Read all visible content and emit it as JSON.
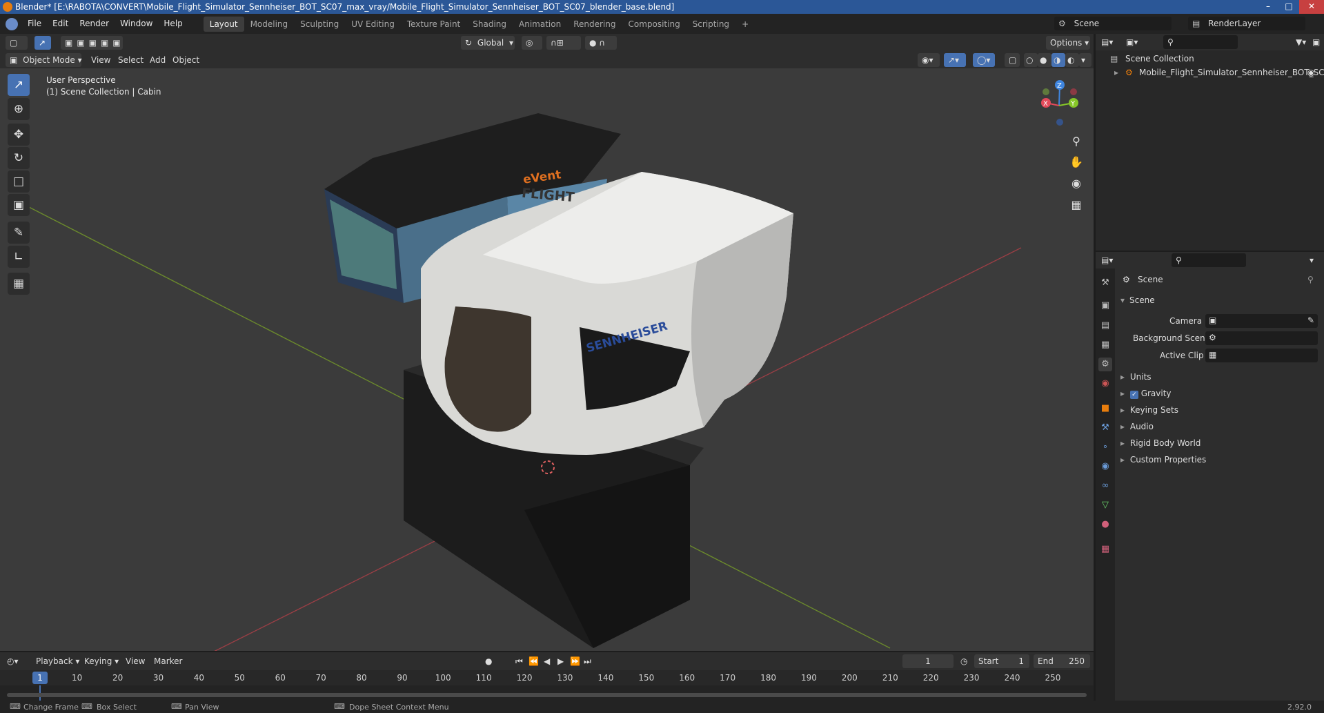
{
  "window": {
    "title": "Blender* [E:\\RABOTA\\CONVERT\\Mobile_Flight_Simulator_Sennheiser_BOT_SC07_max_vray/Mobile_Flight_Simulator_Sennheiser_BOT_SC07_blender_base.blend]"
  },
  "menu": {
    "items": [
      "File",
      "Edit",
      "Render",
      "Window",
      "Help"
    ]
  },
  "workspaces": [
    "Layout",
    "Modeling",
    "Sculpting",
    "UV Editing",
    "Texture Paint",
    "Shading",
    "Animation",
    "Rendering",
    "Compositing",
    "Scripting"
  ],
  "active_workspace": "Layout",
  "add_workspace": "+",
  "scene_selector": {
    "value": "Scene"
  },
  "renderlayer_selector": {
    "value": "RenderLayer"
  },
  "viewport_header": {
    "transform_orientation": "Global",
    "options": "Options",
    "mode": "Object Mode",
    "menus": [
      "View",
      "Select",
      "Add",
      "Object"
    ]
  },
  "viewport": {
    "perspective": "User Perspective",
    "collection_info": "(1) Scene Collection | Cabin",
    "model_text": {
      "brand_top": "eVent",
      "brand_flight": "FLIGHT",
      "brand_side": "SENNHEISER"
    },
    "gizmo": {
      "z": "Z",
      "y": "Y",
      "x": "X"
    }
  },
  "outliner": {
    "root": "Scene Collection",
    "item": "Mobile_Flight_Simulator_Sennheiser_BOT_SC"
  },
  "properties": {
    "header": "Scene",
    "panel_title": "Scene",
    "fields": [
      {
        "label": "Camera",
        "value": ""
      },
      {
        "label": "Background Scene",
        "value": ""
      },
      {
        "label": "Active Clip",
        "value": ""
      }
    ],
    "sections": [
      "Units",
      "Gravity",
      "Keying Sets",
      "Audio",
      "Rigid Body World",
      "Custom Properties"
    ],
    "gravity_checked": true
  },
  "timeline": {
    "menus": [
      "Playback",
      "Keying",
      "View",
      "Marker"
    ],
    "current_frame": "1",
    "start_label": "Start",
    "start": "1",
    "end_label": "End",
    "end": "250",
    "ticks": [
      "1",
      "10",
      "20",
      "30",
      "40",
      "50",
      "60",
      "70",
      "80",
      "90",
      "100",
      "110",
      "120",
      "130",
      "140",
      "150",
      "160",
      "170",
      "180",
      "190",
      "200",
      "210",
      "220",
      "230",
      "240",
      "250"
    ]
  },
  "status": {
    "items": [
      "Change Frame",
      "Box Select",
      "Pan View",
      "Dope Sheet Context Menu"
    ],
    "version": "2.92.0"
  },
  "colors": {
    "accent": "#4772b3",
    "x_axis": "#e44a5a",
    "y_axis": "#86c728",
    "z_axis": "#3f86e0",
    "viewport_bg": "#3b3b3b"
  }
}
